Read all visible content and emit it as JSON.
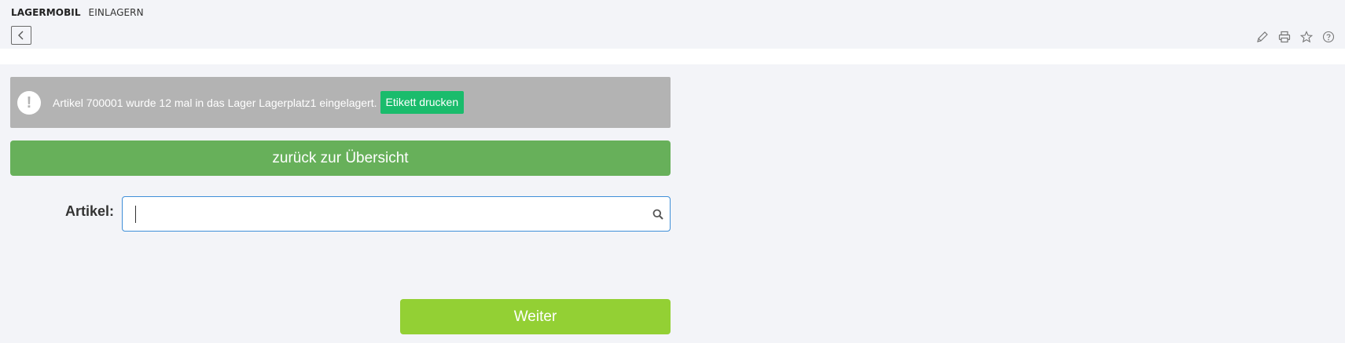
{
  "header": {
    "app_name": "LAGERMOBIL",
    "page_name": "EINLAGERN",
    "back_icon": "chevron-left-icon",
    "toolbar_icons": [
      "pencil-icon",
      "printer-icon",
      "star-icon",
      "help-icon"
    ]
  },
  "notice": {
    "icon": "exclamation-icon",
    "message": "Artikel 700001 wurde 12 mal in das Lager Lagerplatz1 eingelagert.",
    "print_button_label": "Etikett drucken",
    "background_color": "#b3b3b3",
    "button_color": "#1abc6c"
  },
  "overview_button": {
    "label": "zurück zur Übersicht",
    "color": "#67b05a"
  },
  "form": {
    "artikel_label": "Artikel:",
    "artikel_value": "",
    "artikel_placeholder": "",
    "search_icon": "search-icon"
  },
  "next_button": {
    "label": "Weiter",
    "color": "#93d034"
  }
}
